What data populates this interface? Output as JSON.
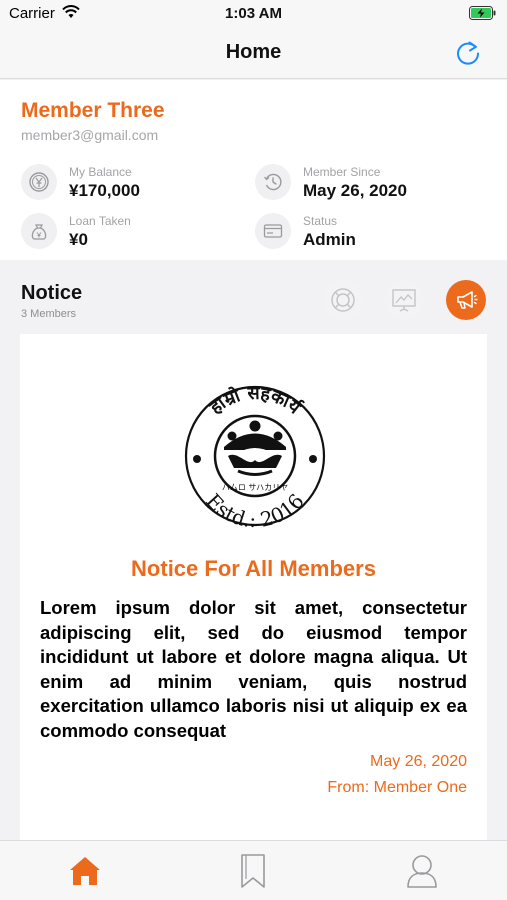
{
  "status_bar": {
    "carrier": "Carrier",
    "time": "1:03 AM"
  },
  "nav": {
    "title": "Home"
  },
  "profile": {
    "name": "Member Three",
    "email": "member3@gmail.com",
    "stats": [
      {
        "label": "My Balance",
        "value": "¥170,000",
        "icon": "yen-coin-icon"
      },
      {
        "label": "Member Since",
        "value": "May 26, 2020",
        "icon": "history-clock-icon"
      },
      {
        "label": "Loan Taken",
        "value": "¥0",
        "icon": "money-bag-icon"
      },
      {
        "label": "Status",
        "value": "Admin",
        "icon": "id-card-icon"
      }
    ]
  },
  "notice": {
    "title": "Notice",
    "subtitle": "3 Members",
    "filters": [
      "lifebuoy-icon",
      "presentation-icon",
      "megaphone-icon"
    ]
  },
  "card": {
    "logo_text": {
      "top": "हाम्रो सहकार्य",
      "middle": "ハムロ サハカリヤ",
      "bottom": "Estd.: 2016"
    },
    "title": "Notice For All Members",
    "body": "Lorem ipsum dolor sit amet, consectetur adipiscing elit, sed do eiusmod tempor incididunt ut labore et dolore magna aliqua. Ut enim ad minim veniam, quis nostrud exercitation ullamco laboris nisi ut aliquip ex ea commodo consequat",
    "date": "May 26, 2020",
    "from": "From: Member One"
  },
  "tabs": [
    "home-icon",
    "bookmark-icon",
    "profile-icon"
  ],
  "colors": {
    "accent": "#ec6a1c",
    "link_blue": "#1a8cff"
  }
}
